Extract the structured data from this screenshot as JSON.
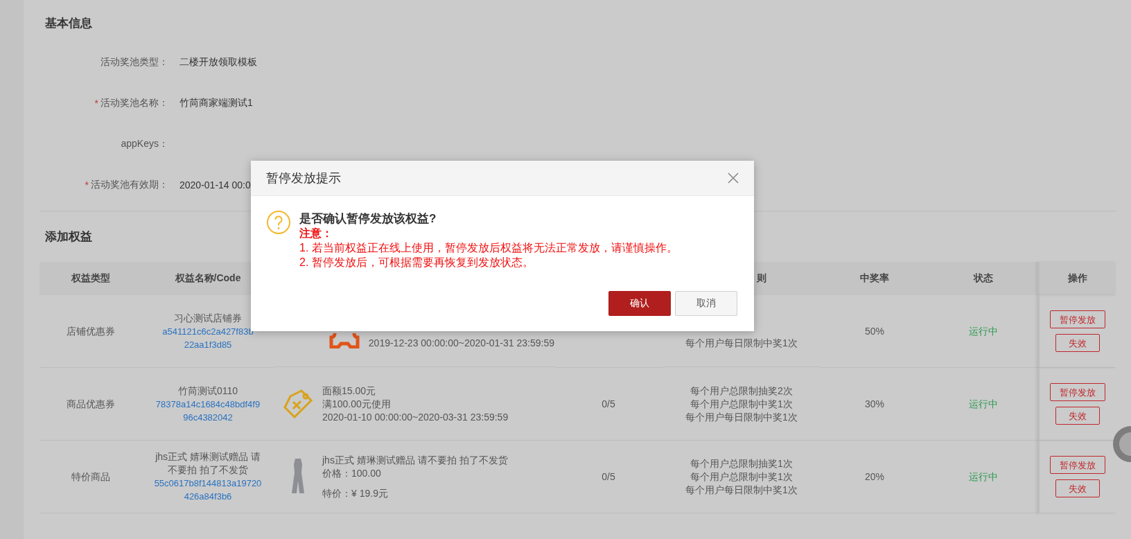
{
  "basic_info": {
    "title": "基本信息",
    "fields": [
      {
        "label": "活动奖池类型：",
        "value": "二楼开放领取模板"
      },
      {
        "label": "活动奖池名称：",
        "value": "竹苘商家端测试1",
        "required_mark": "*"
      },
      {
        "label": "appKeys："
      },
      {
        "label": "活动奖池有效期：",
        "value": "2020-01-14 00:0",
        "required_mark": "*"
      }
    ]
  },
  "rights": {
    "title": "添加权益",
    "columns": {
      "type": "权益类型",
      "name": "权益名称/Code",
      "column_5": "则",
      "rate": "中奖率",
      "status": "状态",
      "actions": "操作"
    },
    "rows": [
      {
        "type": "店铺优惠券",
        "name": "习心测试店铺券",
        "code_lines": [
          "a541121c6c2a427f83b",
          "22aa1f3d85"
        ],
        "kind": "coupon",
        "desc_lines": [
          "2019-12-23 00:00:00~2020-01-31 23:59:59"
        ],
        "rules": [
          "每个用户每日限制中奖1次"
        ],
        "rate": "50%",
        "status": "运行中",
        "actions": [
          "暂停发放",
          "失效"
        ]
      },
      {
        "type": "商品优惠券",
        "name": "竹苘测试0110",
        "code_lines": [
          "78378a14c1684c48bdf4f9",
          "96c4382042"
        ],
        "kind": "tag",
        "desc_lines": [
          "面额15.00元",
          "满100.00元使用",
          "2020-01-10 00:00:00~2020-03-31 23:59:59"
        ],
        "count": "0/5",
        "rules": [
          "每个用户总限制抽奖2次",
          "每个用户总限制中奖1次",
          "每个用户每日限制中奖1次"
        ],
        "rate": "30%",
        "status": "运行中",
        "actions": [
          "暂停发放",
          "失效"
        ]
      },
      {
        "type": "特价商品",
        "name": "jhs正式 婧琳测试赠品 请不要拍 拍了不发货",
        "code_lines": [
          "55c0617b8f144813a19720",
          "426a84f3b6"
        ],
        "kind": "photo",
        "desc_lines": [
          "jhs正式 婧琳测试赠品 请不要拍 拍了不发货",
          "价格：100.00",
          "特价：¥ 19.9元"
        ],
        "count": "0/5",
        "rules": [
          "每个用户总限制抽奖1次",
          "每个用户总限制中奖1次",
          "每个用户每日限制中奖1次"
        ],
        "rate": "20%",
        "status": "运行中",
        "actions": [
          "暂停发放",
          "失效"
        ]
      }
    ]
  },
  "dialog": {
    "title": "暂停发放提示",
    "question": "是否确认暂停发放该权益?",
    "note_title": "注意：",
    "notes": [
      "1. 若当前权益正在线上使用，暂停发放后权益将无法正常发放，请谨慎操作。",
      "2. 暂停发放后，可根据需要再恢复到发放状态。"
    ],
    "buttons": [
      {
        "label": "确认",
        "primary": true
      },
      {
        "label": "取消",
        "primary": false
      }
    ]
  }
}
